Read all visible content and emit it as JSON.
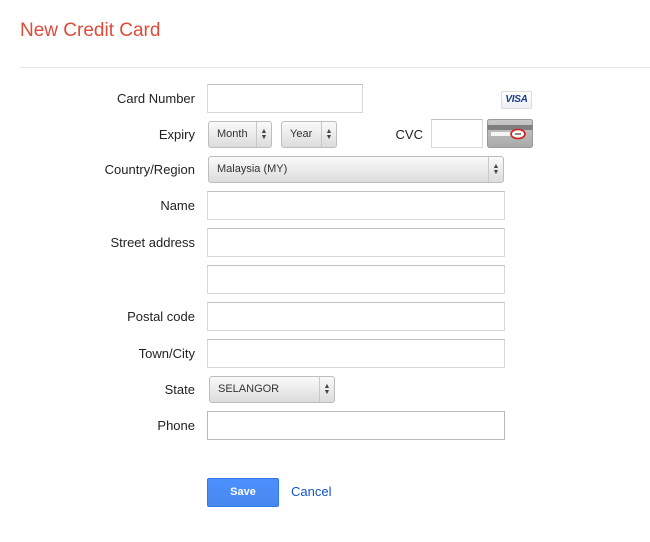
{
  "page_title": "New Credit Card",
  "form": {
    "card_number_label": "Card Number",
    "card_number_value": "",
    "card_brand": "VISA",
    "expiry_label": "Expiry",
    "expiry_month": "Month",
    "expiry_year": "Year",
    "cvc_label": "CVC",
    "cvc_value": "",
    "country_label": "Country/Region",
    "country_value": "Malaysia (MY)",
    "name_label": "Name",
    "name_value": "",
    "street_label": "Street address",
    "street_line1": "",
    "street_line2": "",
    "postal_label": "Postal code",
    "postal_value": "",
    "city_label": "Town/City",
    "city_value": "",
    "state_label": "State",
    "state_value": "SELANGOR",
    "phone_label": "Phone",
    "phone_value": ""
  },
  "actions": {
    "save_label": "Save",
    "cancel_label": "Cancel"
  },
  "colors": {
    "title": "#dd4b39",
    "primary_button": "#4d90fe",
    "link": "#1155cc",
    "cvc_highlight": "#d01c1c"
  },
  "icons": {
    "card_brand": "visa-logo-icon",
    "cvc_hint": "card-back-cvc-icon",
    "select_arrows": "select-updown-arrows-icon"
  }
}
